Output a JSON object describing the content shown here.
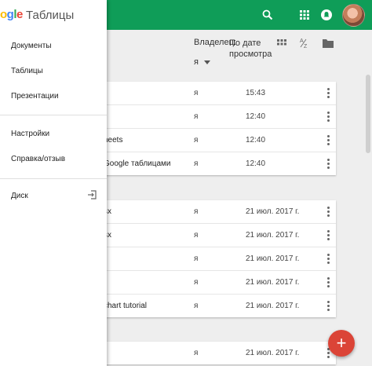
{
  "app": {
    "title_partial": "ы",
    "brand": "Таблицы"
  },
  "colors": {
    "accent": "#0f9d58",
    "fab": "#db4437"
  },
  "topbar_icons": [
    "search-icon",
    "apps-grid-icon",
    "notifications-icon",
    "avatar"
  ],
  "list_header": {
    "owner_label": "Владелец:",
    "owner_value": "я",
    "date_label": "По дате просмотра"
  },
  "sections": [
    {
      "rows": [
        {
          "name": "",
          "owner": "я",
          "date": "15:43"
        },
        {
          "name": "",
          "owner": "я",
          "date": "12:40"
        },
        {
          "name": "heets",
          "owner": "я",
          "date": "12:40"
        },
        {
          "name": "Google таблицами",
          "owner": "я",
          "date": "12:40"
        }
      ]
    },
    {
      "rows": [
        {
          "name": "sx",
          "owner": "я",
          "date": "21 июл. 2017 г."
        },
        {
          "name": "sx",
          "owner": "я",
          "date": "21 июл. 2017 г."
        },
        {
          "name": "",
          "owner": "я",
          "date": "21 июл. 2017 г."
        },
        {
          "name": "",
          "owner": "я",
          "date": "21 июл. 2017 г."
        },
        {
          "name": "chart tutorial",
          "owner": "я",
          "date": "21 июл. 2017 г."
        }
      ]
    },
    {
      "rows": [
        {
          "name": "",
          "owner": "я",
          "date": "21 июл. 2017 г."
        }
      ]
    }
  ],
  "drawer": {
    "logo_text": "ogle",
    "title": "Таблицы",
    "items": [
      {
        "label": "Документы"
      },
      {
        "label": "Таблицы"
      },
      {
        "label": "Презентации"
      },
      {
        "label": "Настройки"
      },
      {
        "label": "Справка/отзыв"
      },
      {
        "label": "Диск"
      }
    ]
  },
  "fab": {
    "label": "+"
  }
}
